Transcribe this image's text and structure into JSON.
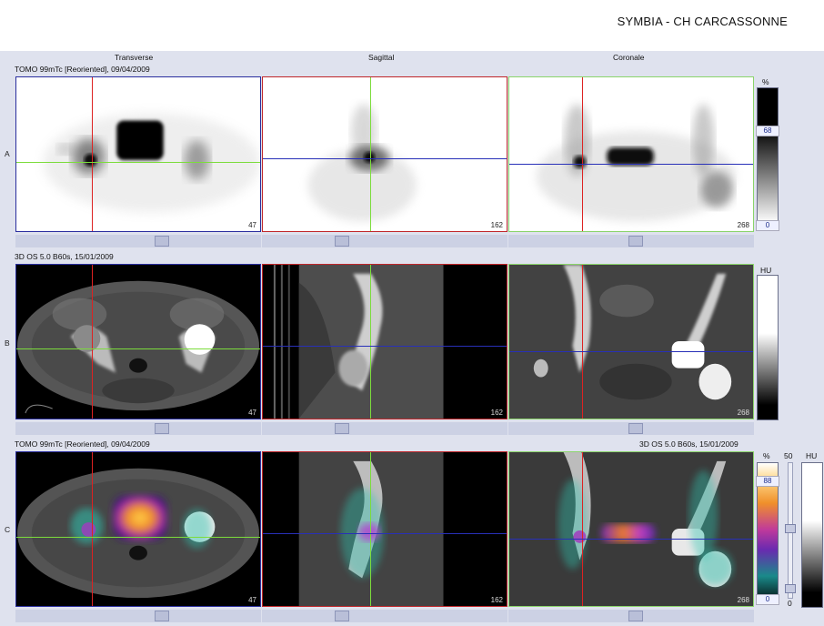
{
  "header": {
    "site": "SYMBIA - CH CARCASSONNE"
  },
  "columns": {
    "transverse": "Transverse",
    "sagittal": "Sagittal",
    "coronal": "Coronale"
  },
  "rows": {
    "a": {
      "letter": "A",
      "series": "TOMO 99mTc [Reoriented], 09/04/2009"
    },
    "b": {
      "letter": "B",
      "series": "3D  OS  5.0  B60s, 15/01/2009"
    },
    "c": {
      "letter": "C",
      "series_left": "TOMO 99mTc [Reoriented], 09/04/2009",
      "series_right": "3D  OS  5.0  B60s, 15/01/2009"
    }
  },
  "slices": {
    "transverse": "47",
    "sagittal": "162",
    "coronal": "268"
  },
  "scales": {
    "a": {
      "unit": "%",
      "top": "68",
      "bottom": "0"
    },
    "b": {
      "unit": "HU"
    },
    "c": {
      "unit_pct": "%",
      "pct_top": "88",
      "pct_bottom": "0",
      "top_value": "50",
      "bottom_value": "0",
      "unit_hu": "HU"
    }
  },
  "colors": {
    "crosshair_red": "#d22222",
    "crosshair_green": "#7cdc3c",
    "crosshair_blue": "#2830b8",
    "panel_bg": "#dfe2ee"
  }
}
